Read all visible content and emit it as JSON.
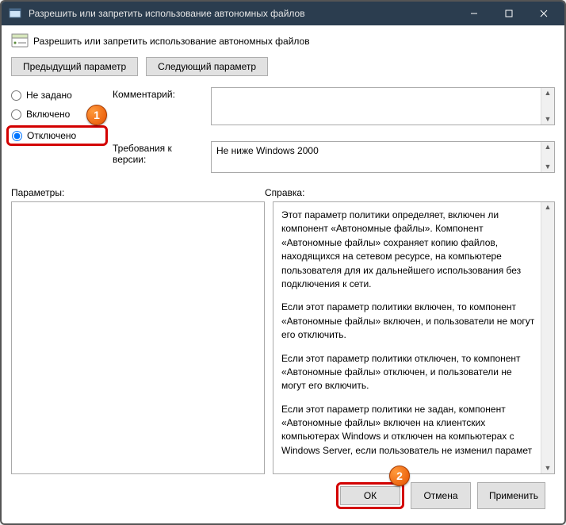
{
  "titlebar": {
    "title": "Разрешить или запретить использование автономных файлов"
  },
  "header": {
    "title": "Разрешить или запретить использование автономных файлов"
  },
  "nav": {
    "prev": "Предыдущий параметр",
    "next": "Следующий параметр"
  },
  "radios": {
    "not_configured": "Не задано",
    "enabled": "Включено",
    "disabled": "Отключено"
  },
  "meta": {
    "comment_label": "Комментарий:",
    "comment_value": "",
    "supported_label": "Требования к версии:",
    "supported_value": "Не ниже Windows 2000"
  },
  "lower": {
    "options_label": "Параметры:",
    "help_label": "Справка:",
    "help_text": {
      "p1": "Этот параметр политики определяет, включен ли компонент «Автономные файлы». Компонент «Автономные файлы» сохраняет копию файлов, находящихся на сетевом ресурсе, на компьютере пользователя для их дальнейшего использования без подключения к сети.",
      "p2": "Если этот параметр политики включен, то компонент «Автономные файлы» включен, и пользователи не могут его отключить.",
      "p3": "Если этот параметр политики отключен, то компонент «Автономные файлы» отключен, и пользователи не могут его включить.",
      "p4": "Если этот параметр политики не задан, компонент «Автономные файлы» включен на клиентских компьютерах Windows и отключен на компьютерах с Windows Server, если пользователь не изменил парамет"
    }
  },
  "footer": {
    "ok": "ОК",
    "cancel": "Отмена",
    "apply": "Применить"
  },
  "annotations": {
    "badge1": "1",
    "badge2": "2"
  }
}
